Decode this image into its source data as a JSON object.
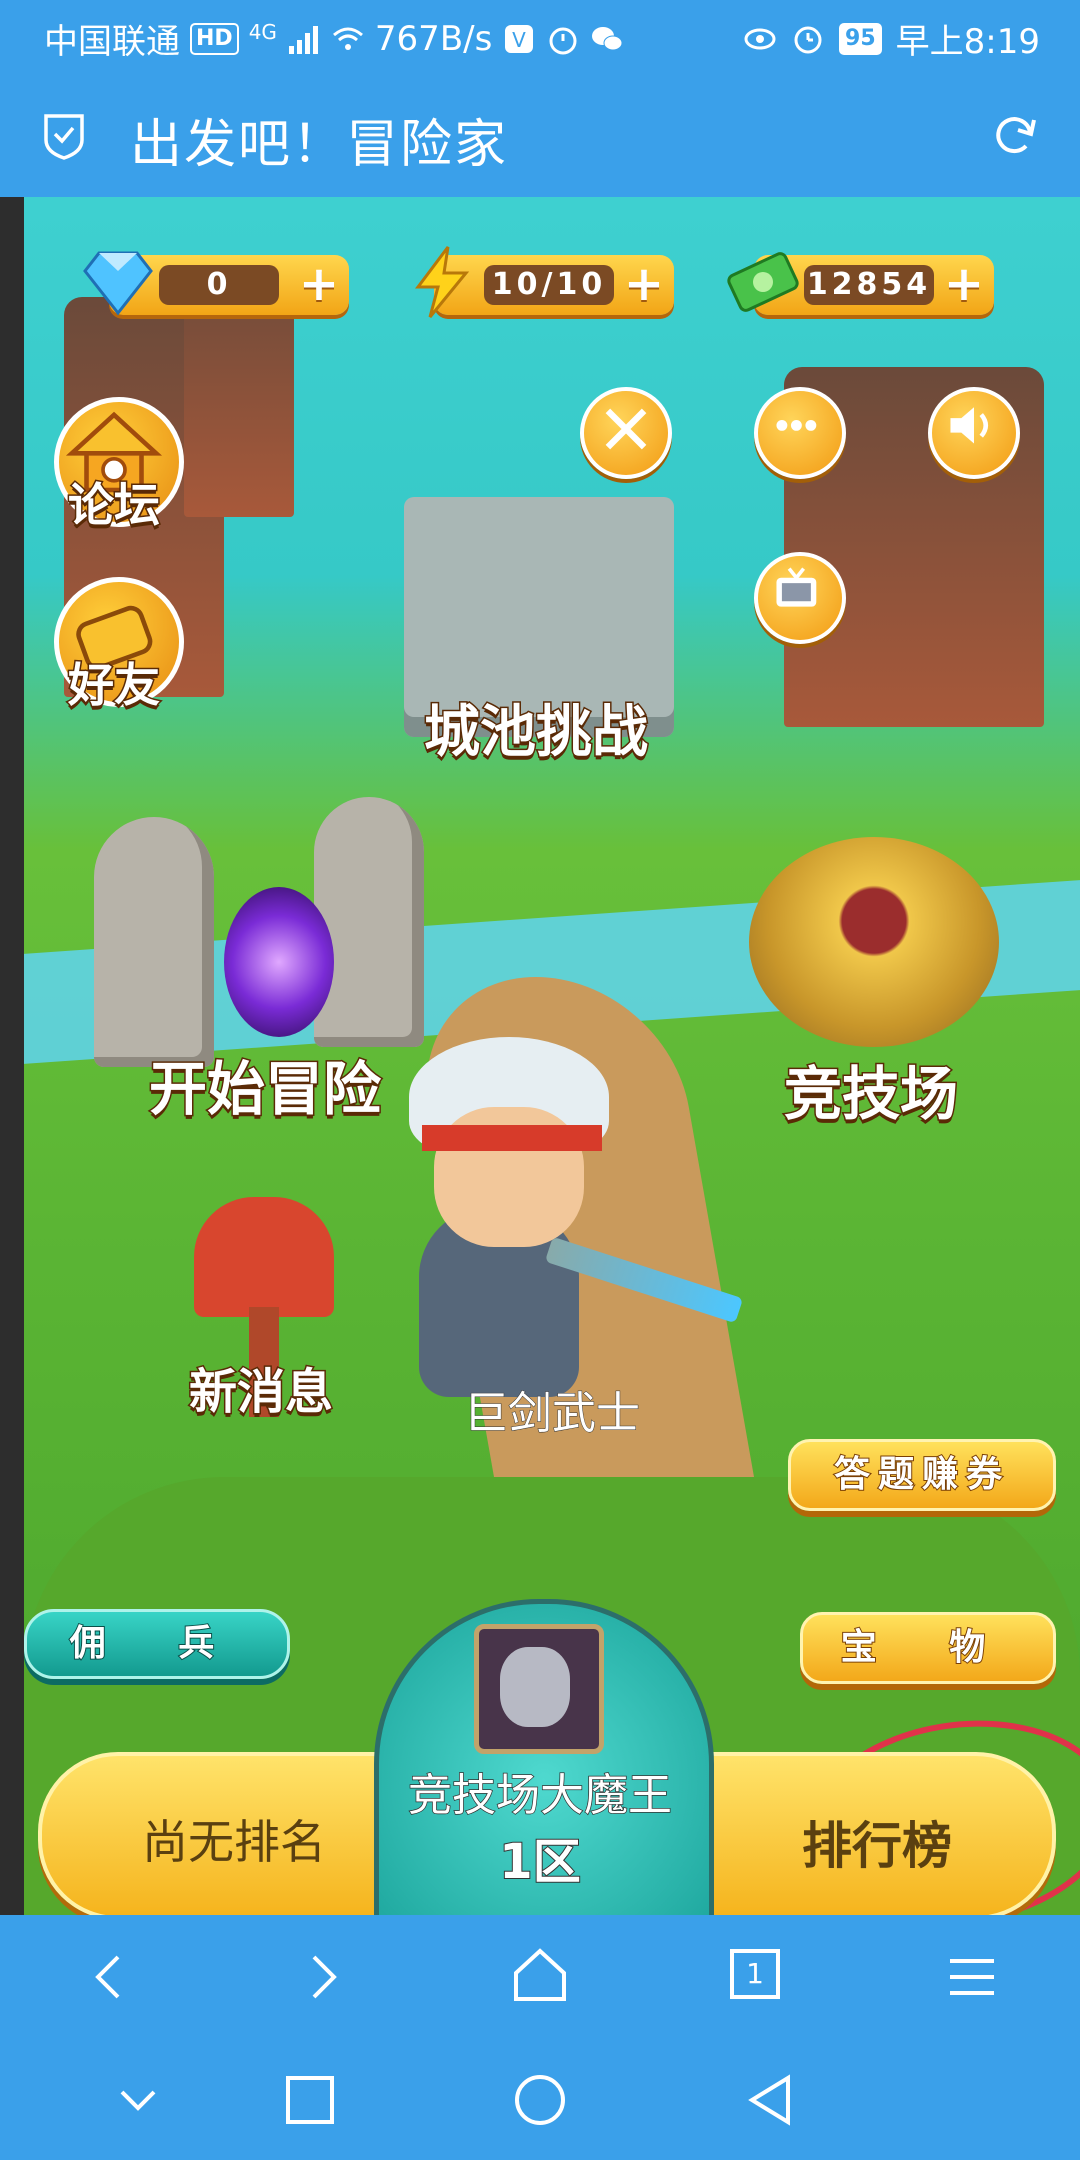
{
  "status_bar": {
    "carrier": "中国联通",
    "hd_badge": "HD",
    "network": "4G",
    "speed": "767B/s",
    "battery": "95",
    "time": "早上8:19"
  },
  "app_bar": {
    "title": "出发吧！冒险家"
  },
  "resources": {
    "gems": "0",
    "energy": "10/10",
    "cash": "12854"
  },
  "side_buttons": {
    "forum": "论坛",
    "friends": "好友"
  },
  "map_locations": {
    "castle": "城池挑战",
    "adventure": "开始冒险",
    "arena": "竞技场",
    "messages": "新消息"
  },
  "hero": {
    "name": "巨剑武士"
  },
  "action_buttons": {
    "quiz": "答题赚券",
    "treasure": "宝 物",
    "mercenary": "佣 兵"
  },
  "bottom_bar": {
    "rank": "尚无排名",
    "leaderboard": "排行榜",
    "boss_title": "竞技场大魔王",
    "zone": "1区"
  },
  "browser_nav": {
    "tab_count": "1"
  },
  "colors": {
    "browser_blue": "#3aa0ea",
    "gold": "#f5b41d",
    "annotation_red": "#e0324a"
  }
}
